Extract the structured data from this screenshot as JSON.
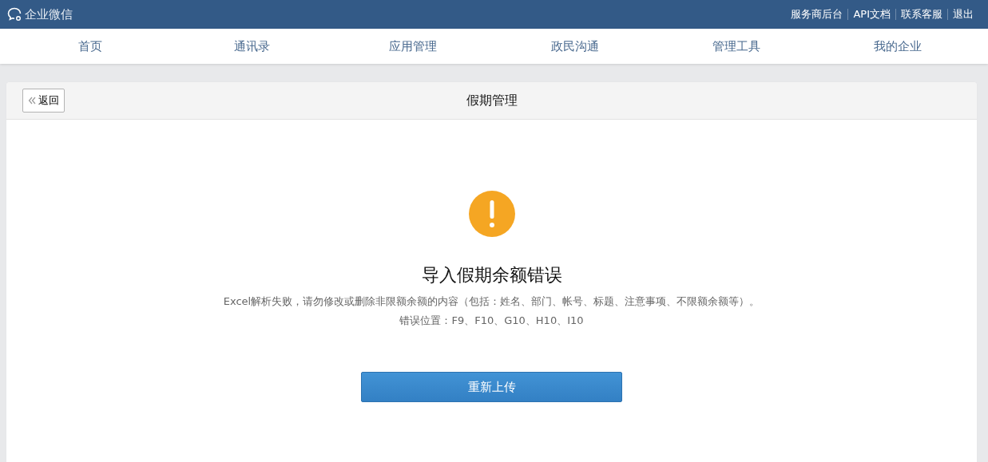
{
  "topbar": {
    "logo": "企业微信",
    "links": [
      "服务商后台",
      "API文档",
      "联系客服",
      "退出"
    ]
  },
  "nav": [
    {
      "label": "首页",
      "selected": false
    },
    {
      "label": "通讯录",
      "selected": false
    },
    {
      "label": "应用管理",
      "selected": false
    },
    {
      "label": "政民沟通",
      "selected": false
    },
    {
      "label": "管理工具",
      "selected": false
    },
    {
      "label": "我的企业",
      "selected": false
    }
  ],
  "panel": {
    "back": "返回",
    "title": "假期管理"
  },
  "result": {
    "kind": "warning",
    "heading": "导入假期余额错误",
    "message": "Excel解析失败，请勿修改或删除非限额余额的内容（包括：姓名、部门、帐号、标题、注意事项、不限额余额等）。",
    "detail": "错误位置：F9、F10、G10、H10、I10",
    "button": "重新上传"
  }
}
